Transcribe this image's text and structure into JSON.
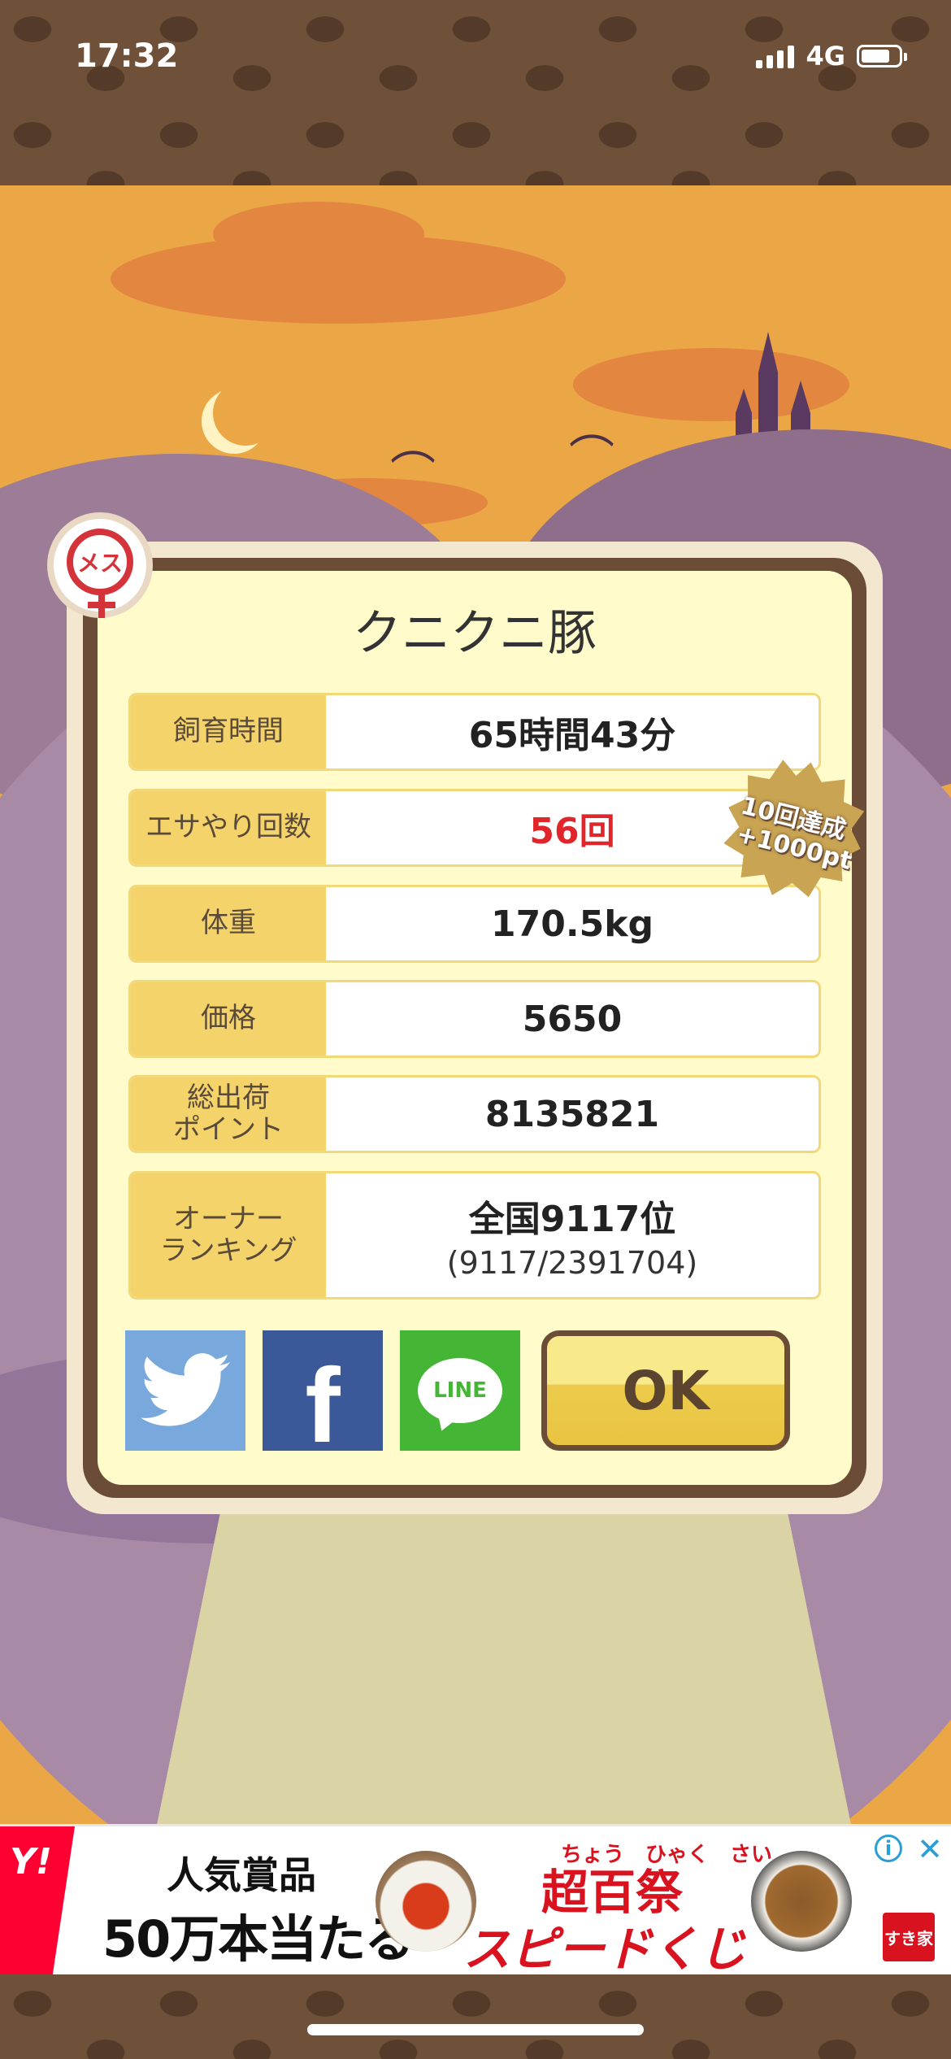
{
  "status_bar": {
    "time": "17:32",
    "network": "4G"
  },
  "badge": {
    "gender_text": "メス"
  },
  "dialog": {
    "pig_name": "クニクニ豚",
    "rows": [
      {
        "label": "飼育時間",
        "value": "65時間43分"
      },
      {
        "label": "エサやり回数",
        "value": "56回"
      },
      {
        "label": "体重",
        "value": "170.5kg"
      },
      {
        "label": "価格",
        "value": "5650"
      },
      {
        "label": "総出荷\nポイント",
        "value": "8135821"
      },
      {
        "label": "オーナー\nランキング",
        "value": "全国9117位",
        "sub": "(9117/2391704)"
      }
    ],
    "achievement": {
      "line1": "10回達成",
      "line2": "+1000pt"
    },
    "share": {
      "line_label": "LINE",
      "facebook_label": "f"
    },
    "ok_label": "OK"
  },
  "ad": {
    "badge": "Y!",
    "line1": "人気賞品",
    "line2": "50万本当たる",
    "title_small": "ちょう　ひゃく　さい",
    "title_main": "超百祭",
    "title_sub": "スピードくじ",
    "logo_text": "すき家",
    "info_icon": "i",
    "close_icon": "✕"
  }
}
